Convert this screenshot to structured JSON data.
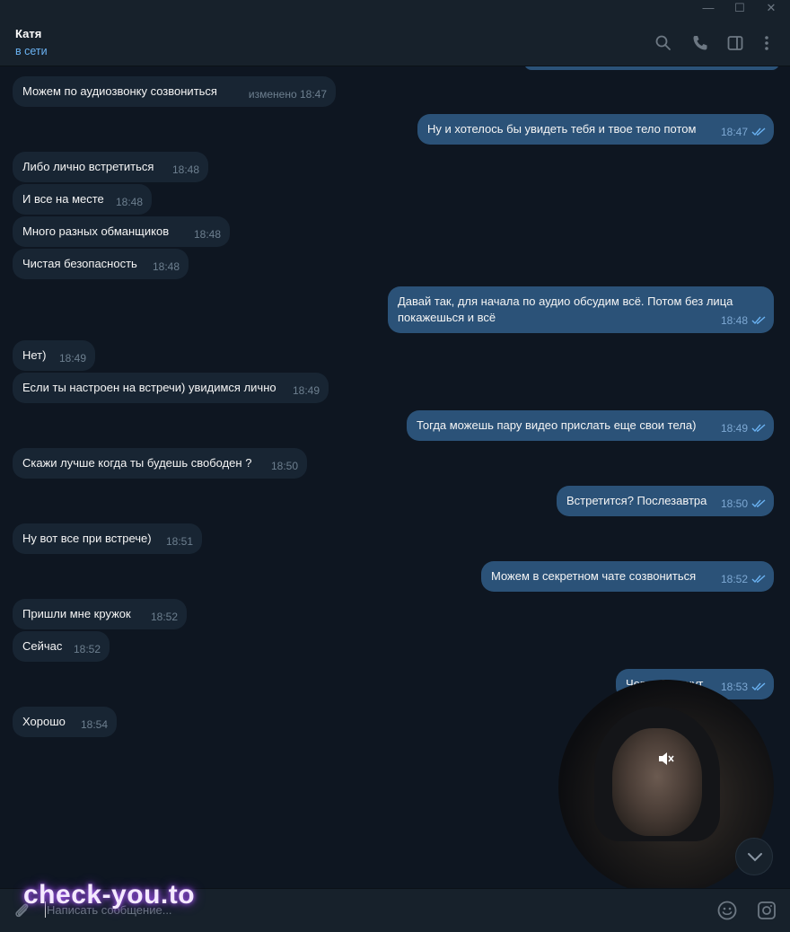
{
  "window": {
    "minimize": "—",
    "maximize": "☐",
    "close": "✕"
  },
  "header": {
    "name": "Катя",
    "status": "в сети"
  },
  "messages": [
    {
      "dir": "in",
      "text": "Можем по аудиозвонку созвониться",
      "time": "изменено 18:47"
    },
    {
      "dir": "out",
      "text": "Ну и хотелось бы увидеть тебя и твое тело потом",
      "time": "18:47"
    },
    {
      "dir": "in",
      "text": "Либо лично встретиться",
      "time": "18:48"
    },
    {
      "dir": "in",
      "text": "И все на месте",
      "time": "18:48"
    },
    {
      "dir": "in",
      "text": "Много разных обманщиков",
      "time": "18:48"
    },
    {
      "dir": "in",
      "text": "Чистая безопасность",
      "time": "18:48"
    },
    {
      "dir": "out",
      "text": "Давай так, для начала по аудио обсудим всё. Потом без лица",
      "text2": "покажешься и всё",
      "time": "18:48"
    },
    {
      "dir": "in",
      "text": "Нет)",
      "time": "18:49"
    },
    {
      "dir": "in",
      "text": "Если ты настроен на встречи) увидимся лично",
      "time": "18:49"
    },
    {
      "dir": "out",
      "text": "Тогда можешь пару видео прислать еще свои тела)",
      "time": "18:49"
    },
    {
      "dir": "in",
      "text": "Скажи лучше когда ты будешь свободен ?",
      "time": "18:50"
    },
    {
      "dir": "out",
      "text": "Встретится? Послезавтра",
      "time": "18:50"
    },
    {
      "dir": "in",
      "text": "Ну вот все при встрече)",
      "time": "18:51"
    },
    {
      "dir": "out",
      "text": "Можем в секретном чате созвониться",
      "time": "18:52"
    },
    {
      "dir": "in",
      "text": "Пришли мне кружок",
      "time": "18:52"
    },
    {
      "dir": "in",
      "text": "Сейчас",
      "time": "18:52"
    },
    {
      "dir": "out",
      "text": "Через 5 минут",
      "time": "18:53"
    },
    {
      "dir": "in",
      "text": "Хорошо",
      "time": "18:54"
    }
  ],
  "input": {
    "placeholder": "Написать сообщение..."
  },
  "watermark": "check-you.to",
  "colors": {
    "bg": "#0e1621",
    "incoming": "#182533",
    "outgoing": "#2b5278",
    "accent": "#6ab2f2"
  },
  "icons": [
    "search-icon",
    "phone-icon",
    "sidebar-icon",
    "more-icon",
    "attach-icon",
    "emoji-icon",
    "camera-icon",
    "mute-icon",
    "chevron-down-icon",
    "double-check-icon"
  ]
}
